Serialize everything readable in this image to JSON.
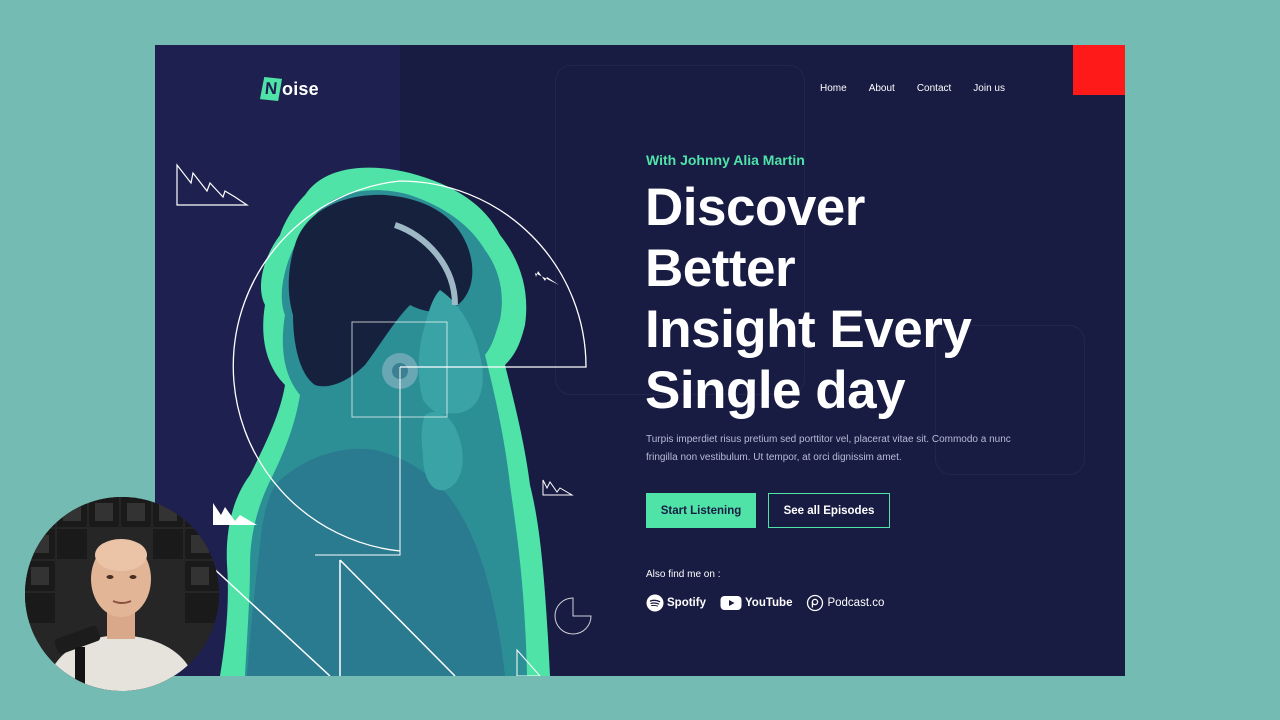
{
  "logo": {
    "mark": "N",
    "text": "oise"
  },
  "nav": {
    "items": [
      {
        "label": "Home"
      },
      {
        "label": "About"
      },
      {
        "label": "Contact"
      },
      {
        "label": "Join us"
      }
    ]
  },
  "hero": {
    "eyebrow": "With Johnny Alia Martin",
    "headline": [
      "Discover",
      "Better",
      "Insight Every",
      "Single day"
    ],
    "description": "Turpis imperdiet risus pretium sed porttitor vel, placerat vitae sit. Commodo a nunc fringilla non vestibulum. Ut tempor, at orci dignissim amet.",
    "primary_button": "Start Listening",
    "secondary_button": "See all Episodes",
    "find_label": "Also find me on :",
    "platforms": [
      {
        "name": "Spotify",
        "icon": "spotify-icon"
      },
      {
        "name": "YouTube",
        "icon": "youtube-icon"
      },
      {
        "name": "Podcast.co",
        "icon": "podcast-icon"
      }
    ]
  },
  "colors": {
    "background": "#74bcb3",
    "page": "#181b42",
    "panel": "#1e2150",
    "accent": "#4fe3a8",
    "red": "#ff1a1a"
  }
}
